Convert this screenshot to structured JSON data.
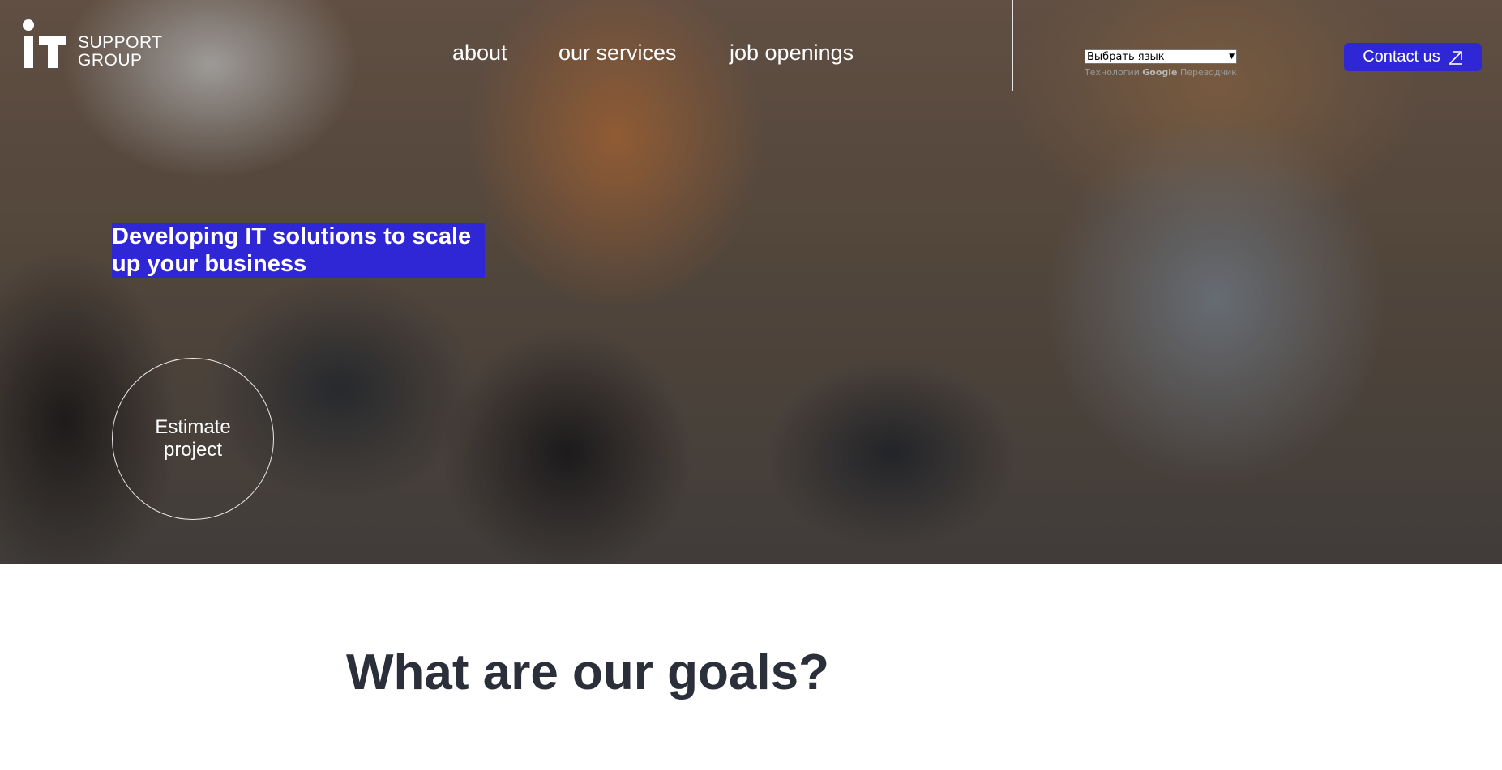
{
  "header": {
    "logo": {
      "line1": "SUPPORT",
      "line2": "GROUP"
    },
    "nav": [
      {
        "label": "about"
      },
      {
        "label": "our services"
      },
      {
        "label": "job openings"
      }
    ],
    "language": {
      "selected": "Выбрать язык",
      "credit_prefix": "Технологии",
      "credit_brand": "Google",
      "credit_suffix": "Переводчик"
    },
    "contact_label": "Contact us",
    "contact_icon": "arrow-up-right-icon"
  },
  "hero": {
    "headline_line1": "Developing IT solutions to scale",
    "headline_line2": "up your business",
    "estimate_line1": "Estimate",
    "estimate_line2": "project",
    "accent_color": "#2f27d6"
  },
  "goals": {
    "title": "What are our goals?"
  }
}
